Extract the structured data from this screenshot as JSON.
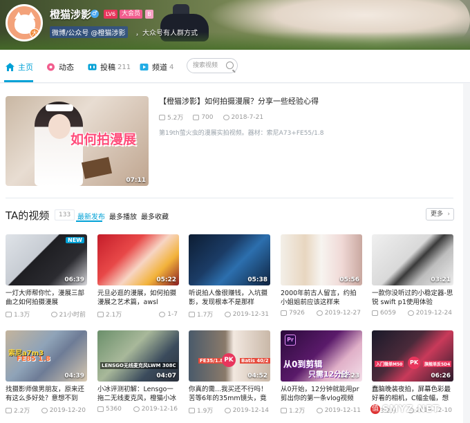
{
  "profile": {
    "name": "橙猫涉影",
    "gender_icon": "♂",
    "level": "LV6",
    "vip": "大会员",
    "nft_badge": "B",
    "sign_part1": "微博/公众号 @橙猫涉影",
    "sign_part2": "，大众号有人群方式"
  },
  "nav": {
    "home": "主页",
    "dynamic": "动态",
    "submit": "投稿",
    "submit_count": "211",
    "channel": "频道",
    "channel_count": "4",
    "search_placeholder": "搜索视频"
  },
  "featured": {
    "title": "【橙猫涉影】如何拍摄漫展？分享一些经验心得",
    "thumb_text": "如何拍漫展",
    "duration": "07:11",
    "plays": "5.2万",
    "danmaku": "700",
    "date": "2018-7-21",
    "desc": "第19th萤火虫的漫展实拍视频。器材：索尼A73+FE55/1.8"
  },
  "section": {
    "title": "TA的视频",
    "count": "133",
    "tab_latest": "最新发布",
    "tab_most_played": "最多播放",
    "tab_most_fav": "最多收藏",
    "more": "更多",
    "more_arrow": "›"
  },
  "videos": [
    {
      "title": "一灯大师帮你忙，漫展三部曲之如何拍摄漫展",
      "duration": "06:39",
      "plays": "1.3万",
      "time": "21小时前",
      "tag": "NEW"
    },
    {
      "title": "元旦必逛的漫展，如何拍摄漫展之艺术篇，awsl",
      "duration": "05:22",
      "plays": "2.1万",
      "time": "1-7"
    },
    {
      "title": "听说拍人像很赚钱，入坑摄影，发现根本不是那样",
      "duration": "05:38",
      "plays": "1.7万",
      "time": "2019-12-31"
    },
    {
      "title": "2000年前古人留言，约拍小姐姐前应该这样来",
      "duration": "05:56",
      "plays": "7926",
      "time": "2019-12-27"
    },
    {
      "title": "一款你没听过的小稳定器-思锐 swift p1使用体验",
      "duration": "03:21",
      "plays": "6059",
      "time": "2019-12-24"
    },
    {
      "title": "找摄影师做男朋友，原来还有这么多好处？意想不到",
      "duration": "04:39",
      "plays": "2.2万",
      "time": "2019-12-20",
      "overlay1": "索尼a7m3",
      "overlay2": "FE85 1.8"
    },
    {
      "title": "小冰评测初解：Lensgo一拖二无线麦克风，橙猫小冰可",
      "duration": "04:07",
      "plays": "5360",
      "time": "2019-12-16",
      "overlay1": "LENSGO无线麦克风LWM 308C"
    },
    {
      "title": "你真的需...我买还不行吗！苦等6年的35mm镜头，竟是这",
      "duration": "04:52",
      "plays": "1.9万",
      "time": "2019-12-14",
      "overlay1": "FE35/1.8",
      "overlay2": "PK",
      "overlay3": "Batis 40/2"
    },
    {
      "title": "从0开始，12分钟就能用pr剪出你的第一条vlog视频",
      "duration": "12:23",
      "plays": "1.2万",
      "time": "2019-12-11",
      "overlay1": "Pr",
      "overlay2": "从0到剪辑",
      "overlay3": "只需12分钟"
    },
    {
      "title": "蠢脑晚装夜拍，屏幕色彩最好看的相机，C幅金幅，想好买",
      "duration": "06:26",
      "plays": "3.2万",
      "time": "2019-12-10",
      "overlay1": "入门微单M50",
      "overlay2": "PK",
      "overlay3": "旗舰单反5D4"
    }
  ],
  "watermark": {
    "mark": "值",
    "text": "SMYZ.NET"
  },
  "colors": {
    "accent": "#00a1d6",
    "pink": "#f25d8e"
  }
}
